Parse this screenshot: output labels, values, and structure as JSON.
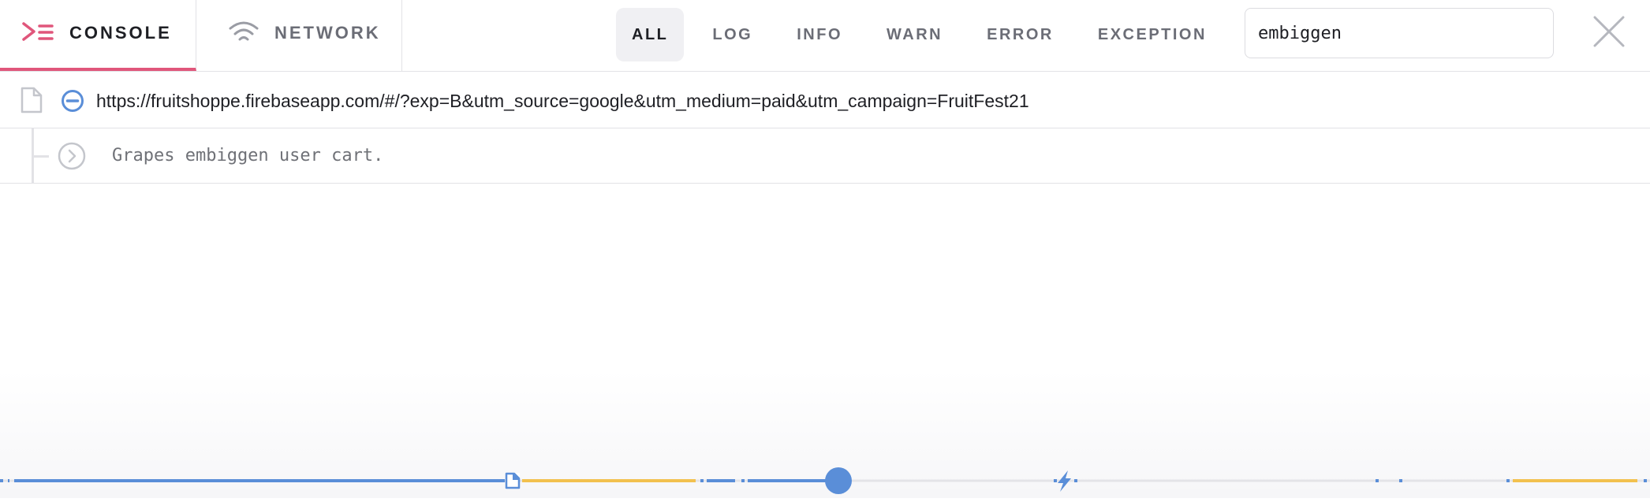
{
  "header": {
    "tabs": [
      {
        "label": "CONSOLE",
        "icon": "console-icon",
        "active": true
      },
      {
        "label": "NETWORK",
        "icon": "wifi-icon",
        "active": false
      }
    ],
    "filters": [
      {
        "label": "ALL",
        "active": true
      },
      {
        "label": "LOG",
        "active": false
      },
      {
        "label": "INFO",
        "active": false
      },
      {
        "label": "WARN",
        "active": false
      },
      {
        "label": "ERROR",
        "active": false
      },
      {
        "label": "EXCEPTION",
        "active": false
      }
    ],
    "search": {
      "value": "embiggen"
    },
    "close_icon": "close-icon"
  },
  "log": {
    "rows": [
      {
        "type": "navigation",
        "icons": [
          "file-icon",
          "block-icon"
        ],
        "text": "https://fruitshoppe.firebaseapp.com/#/?exp=B&utm_source=google&utm_medium=paid&utm_campaign=FruitFest21"
      },
      {
        "type": "message",
        "icons": [
          "jump-icon"
        ],
        "text": "Grapes embiggen user cart."
      }
    ]
  },
  "timeline": {
    "icons": [
      "page-icon",
      "playhead-icon",
      "lightning-icon"
    ]
  },
  "colors": {
    "accent_console": "#e0567b",
    "icon_blue": "#5a8ed8",
    "timeline_blue": "#5a8ed8",
    "timeline_yellow": "#f2c14e",
    "timeline_gray": "#e4e4e8",
    "text_dark": "#1e1f24",
    "text_muted": "#6b6d76"
  }
}
